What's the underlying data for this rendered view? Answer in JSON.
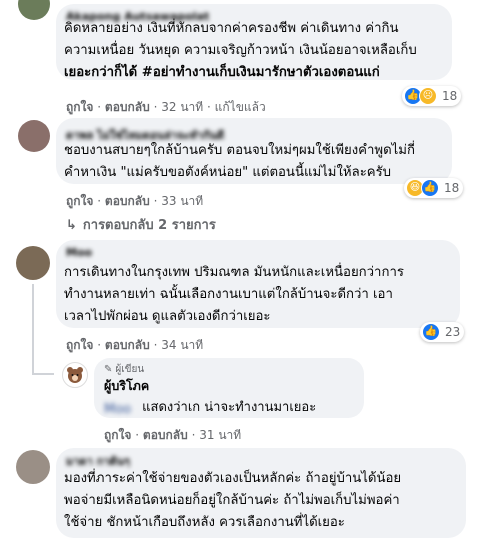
{
  "comments": [
    {
      "name": "Akapong Autsawapolat",
      "lines": [
        "คิดหลายอย่าง เงินที่หักลบจากค่าครองชีพ ค่าเดินทาง ค่ากิน",
        "ความเหนื่อย วันหยุด ความเจริญก้าวหน้า เงินน้อยอาจเหลือเก็บ",
        "เยอะกว่าก็ได้ #อย่าทำงานเก็บเงินมารักษาตัวเองตอนแก่"
      ],
      "like": "ถูกใจ",
      "reply": "ตอบกลับ",
      "time": "32 นาที",
      "edited": "แก้ไขแล้ว",
      "react_count": "18"
    },
    {
      "name": "ดาพล ไม่ใช่ไหมดอนล่าจะทำกันดี",
      "lines": [
        "ชอบงานสบายๆใกล้บ้านครับ ตอนจบใหม่ๆผมใช้เพียงคำพูดไม่กี่",
        "คำหาเงิน \"แม่ครับขอตังค์หน่อย\" แต่ตอนนี้แม่ไม่ให้ละครับ"
      ],
      "like": "ถูกใจ",
      "reply": "ตอบกลับ",
      "time": "33 นาที",
      "react_count": "18"
    },
    {
      "name": "Moo",
      "lines": [
        "การเดินทางในกรุงเทพ ปริมณฑล มันหนักและเหนื่อยกว่าการ",
        "ทำงานหลายเท่า ฉนั้นเลือกงานเบาแต่ใกล้บ้านจะดีกว่า เอา",
        "เวลาไปพักผ่อน ดูแลตัวเองดีกว่าเยอะ"
      ],
      "like": "ถูกใจ",
      "reply": "ตอบกลับ",
      "time": "34 นาที",
      "react_count": "23"
    },
    {
      "name": "มาดา กาต้นๆ",
      "lines": [
        "มองที่ภาระค่าใช้จ่ายของตัวเองเป็นหลักค่ะ ถ้าอยู่บ้านได้น้อย",
        "พอจ่ายมีเหลือนิดหน่อยก็อยู่ใกล้บ้านค่ะ ถ้าไม่พอเก็บไม่พอค่า",
        "ใช้จ่าย ชักหน้าเกือบถึงหลัง ควรเลือกงานที่ได้เยอะ"
      ]
    }
  ],
  "view_replies": "การตอบกลับ 2 รายการ",
  "author_reply": {
    "badge": "ผู้เขียน",
    "name": "ผู้บริโภค",
    "mention": "Moo",
    "text": "แสดงว่าเก น่าจะทำงานมาเยอะ",
    "like": "ถูกใจ",
    "reply": "ตอบกลับ",
    "time": "31 นาที"
  },
  "colors": {
    "link": "#65676b",
    "like_blue": "#1877f2",
    "bubble": "#f0f2f5"
  }
}
